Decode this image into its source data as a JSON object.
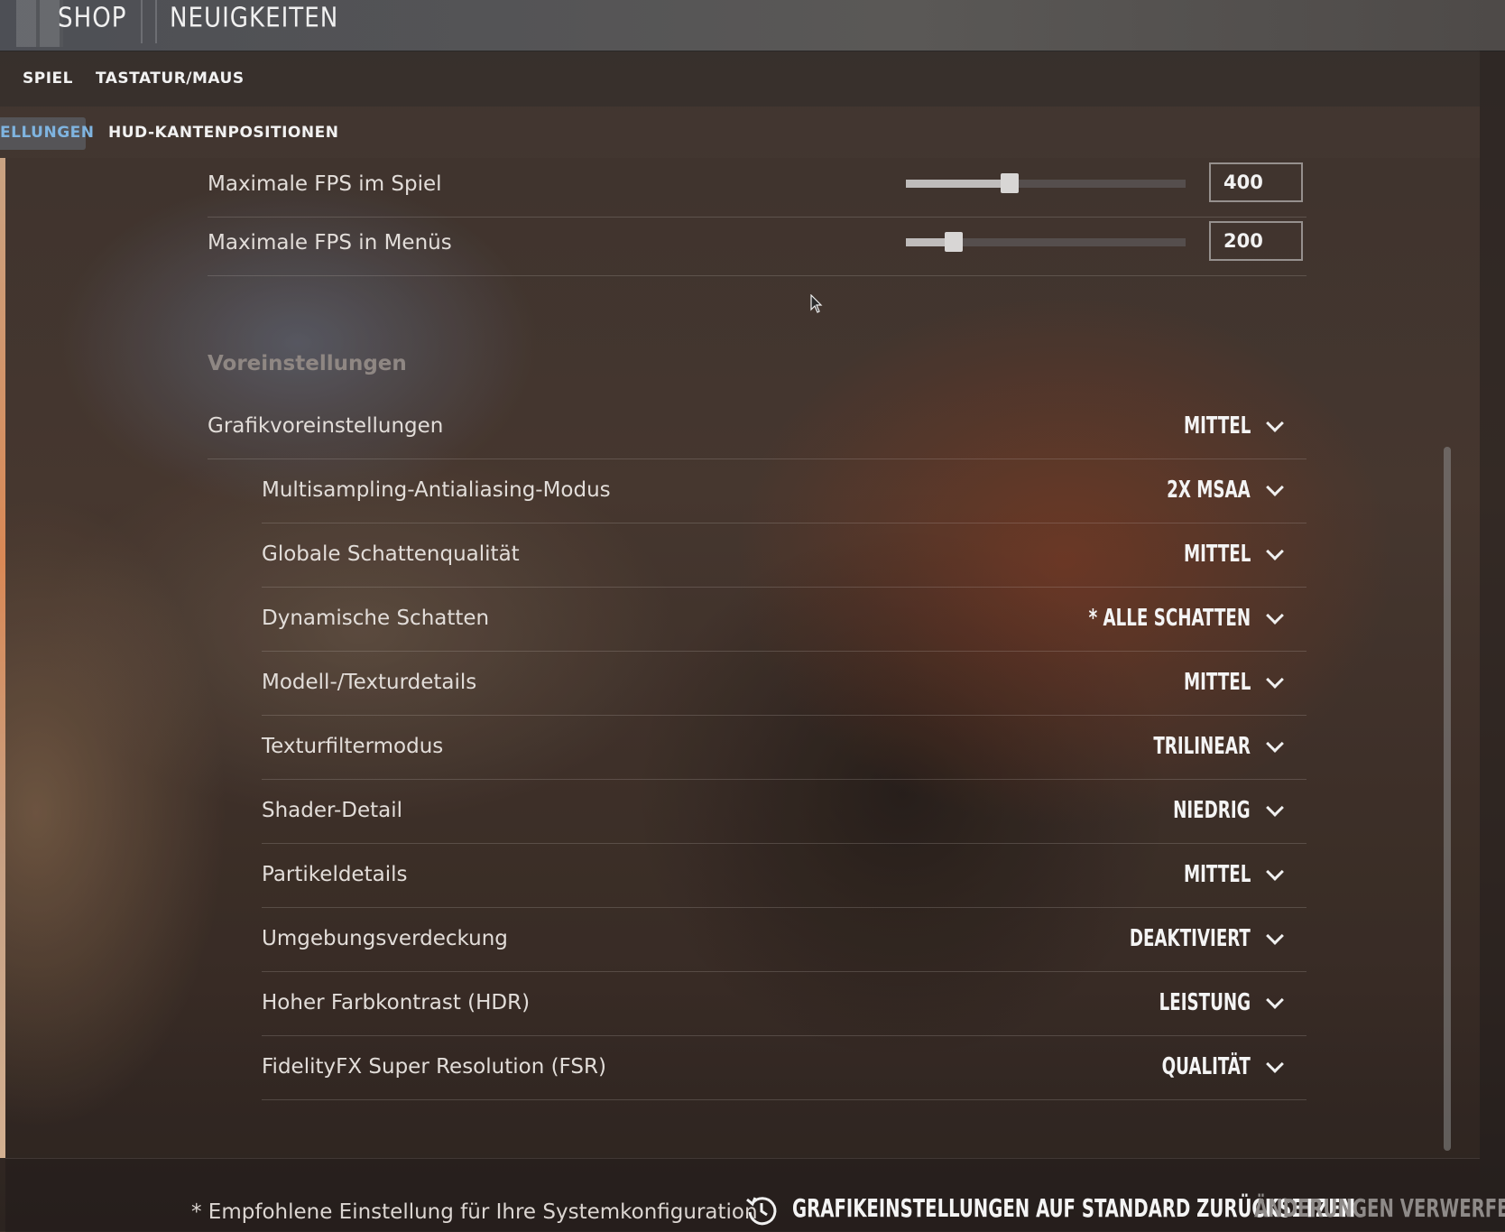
{
  "topbar": {
    "shop": "SHOP",
    "news": "NEUIGKEITEN"
  },
  "nav1": {
    "game": "SPIEL",
    "keyboard_mouse": "TASTATUR/MAUS"
  },
  "nav2": {
    "active_tab": "ELLUNGEN",
    "hud": "HUD-KANTENPOSITIONEN"
  },
  "fps": [
    {
      "label": "Maximale FPS im Spiel",
      "value": "400",
      "fraction": 0.37
    },
    {
      "label": "Maximale FPS in Menüs",
      "value": "200",
      "fraction": 0.17
    }
  ],
  "presets_section": "Voreinstellungen",
  "graphics_preset": {
    "label": "Grafikvoreinstellungen",
    "value": "MITTEL"
  },
  "settings": [
    {
      "label": "Multisampling-Antialiasing-Modus",
      "value": "2X MSAA"
    },
    {
      "label": "Globale Schattenqualität",
      "value": "MITTEL"
    },
    {
      "label": "Dynamische Schatten",
      "value": "* ALLE SCHATTEN"
    },
    {
      "label": "Modell-/Texturdetails",
      "value": "MITTEL"
    },
    {
      "label": "Texturfiltermodus",
      "value": "TRILINEAR"
    },
    {
      "label": "Shader-Detail",
      "value": "NIEDRIG"
    },
    {
      "label": "Partikeldetails",
      "value": "MITTEL"
    },
    {
      "label": "Umgebungsverdeckung",
      "value": "DEAKTIVIERT"
    },
    {
      "label": "Hoher Farbkontrast (HDR)",
      "value": "LEISTUNG"
    },
    {
      "label": "FidelityFX Super Resolution (FSR)",
      "value": "QUALITÄT"
    }
  ],
  "footer": {
    "note": "* Empfohlene Einstellung für Ihre Systemkonfiguration",
    "reset": "GRAFIKEINSTELLUNGEN AUF STANDARD ZURÜCKSETZEN",
    "discard": "ÄNDERUNGEN VERWERFEN"
  },
  "colors": {
    "active_tab_text": "#7fb4e0",
    "section_title": "#8f8783"
  }
}
